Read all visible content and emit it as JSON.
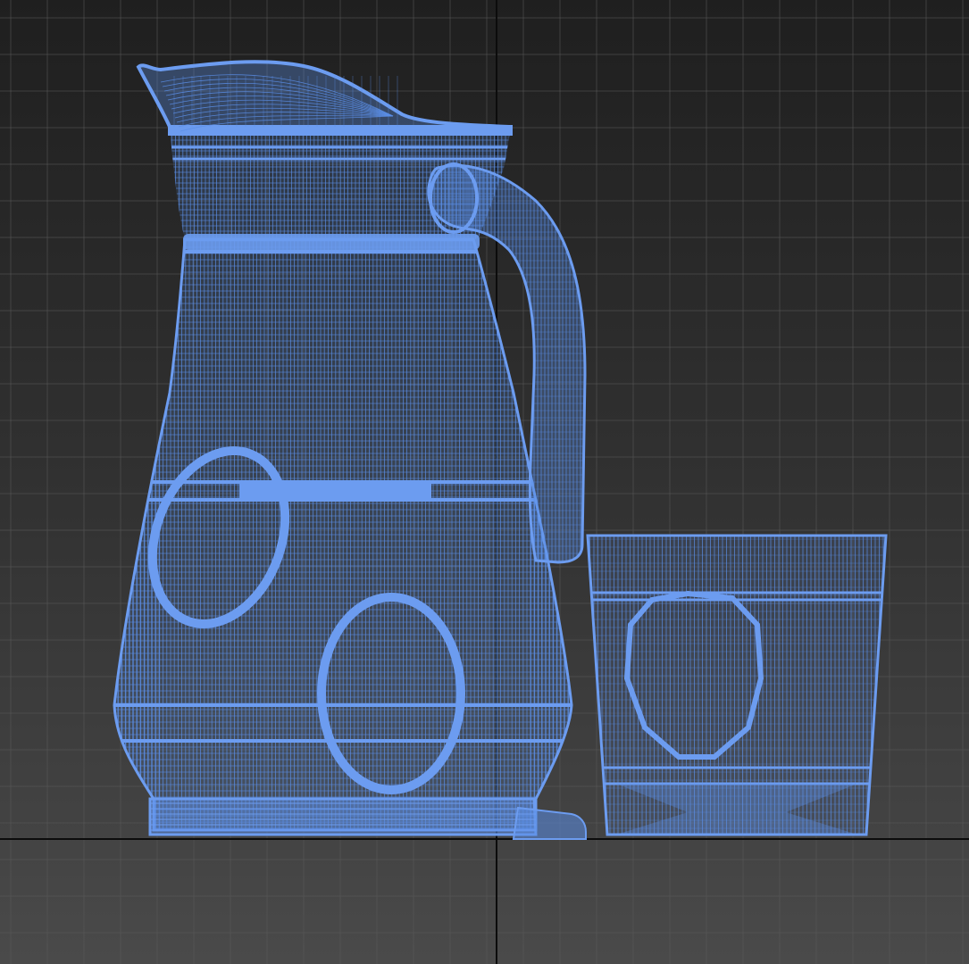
{
  "viewport": {
    "view": "front",
    "display_mode": "wireframe",
    "grid": true,
    "colors": {
      "background_top": "#1f1f1f",
      "background_bottom": "#4a4a4a",
      "grid_line": "#5a5a5a",
      "axis_line": "#0c0c0c",
      "wireframe": "#5b8ee6",
      "wireframe_dense": "#6c9cf0"
    }
  },
  "scene": {
    "objects": [
      {
        "name": "pitcher",
        "type": "mesh"
      },
      {
        "name": "pitcher-handle",
        "type": "mesh"
      },
      {
        "name": "lemon-slice",
        "type": "mesh",
        "count": 2
      },
      {
        "name": "glass",
        "type": "mesh"
      },
      {
        "name": "glass-lemon-slice",
        "type": "mesh"
      }
    ]
  }
}
